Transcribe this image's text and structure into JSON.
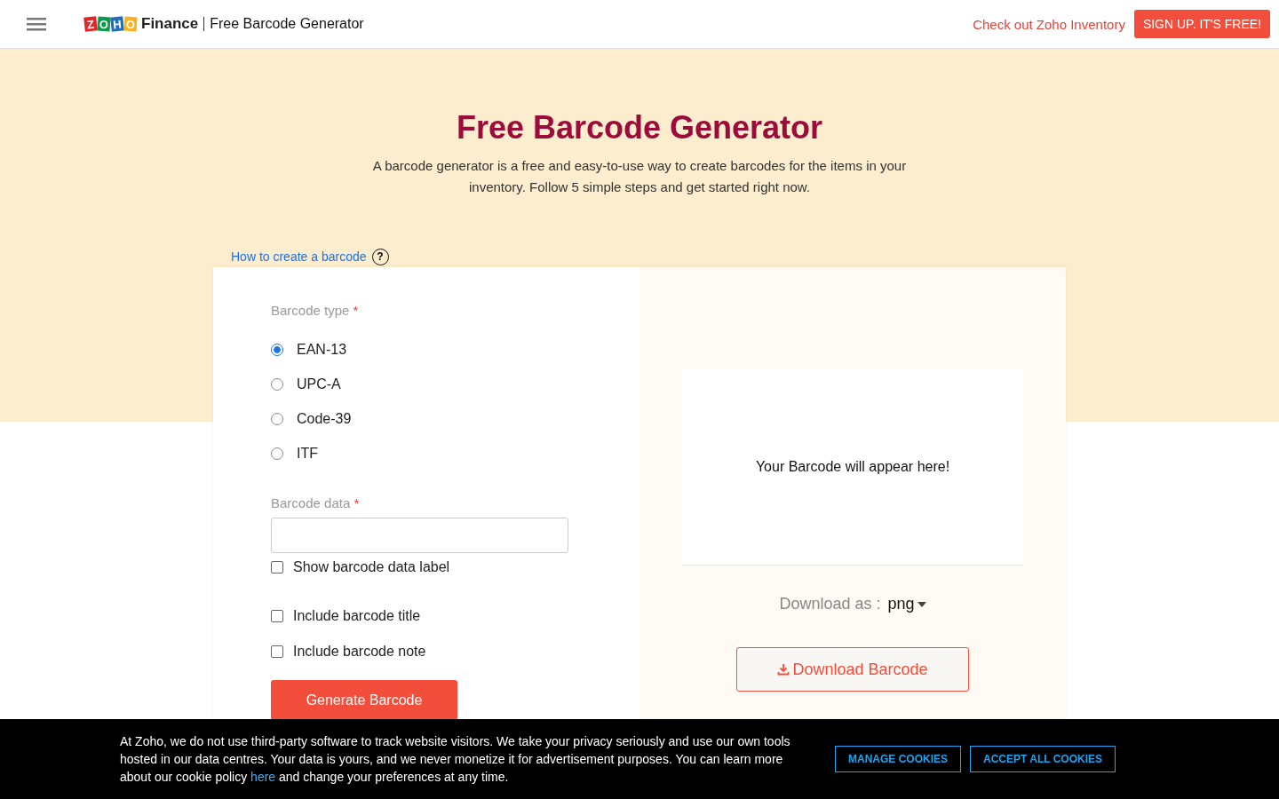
{
  "header": {
    "logo_letters": [
      {
        "text": "Z",
        "color": "#e42527"
      },
      {
        "text": "O",
        "color": "#089949"
      },
      {
        "text": "H",
        "color": "#226db4"
      },
      {
        "text": "O",
        "color": "#f9b21d"
      }
    ],
    "brand": "Finance",
    "page_name": "Free Barcode Generator",
    "link": "Check out Zoho Inventory",
    "signup": "SIGN UP. IT'S FREE!"
  },
  "hero": {
    "title": "Free Barcode Generator",
    "description": "A barcode generator is a free and easy-to-use way to create barcodes for the items in your inventory. Follow 5 simple steps and get started right now.",
    "help_link": "How to create a barcode",
    "help_icon": "?"
  },
  "form": {
    "type_label": "Barcode type",
    "required_mark": "*",
    "types": [
      {
        "label": "EAN-13",
        "selected": true
      },
      {
        "label": "UPC-A",
        "selected": false
      },
      {
        "label": "Code-39",
        "selected": false
      },
      {
        "label": "ITF",
        "selected": false
      }
    ],
    "data_label": "Barcode data",
    "data_required_mark": "*",
    "options": [
      {
        "label": "Show barcode data label",
        "checked": false
      },
      {
        "label": "Include barcode title",
        "checked": false
      },
      {
        "label": "Include barcode note",
        "checked": false
      }
    ],
    "generate": "Generate Barcode"
  },
  "preview": {
    "placeholder": "Your Barcode will appear here!",
    "download_label": "Download as :",
    "format": "png",
    "download_button": "Download Barcode"
  },
  "cookie_banner": {
    "text_before": "At Zoho, we do not use third-party software to track website visitors. We take your privacy seriously and use our own tools hosted in our data centres. Your data is yours, and we never monetize it for advertisement purposes. You can learn more about our cookie policy",
    "link": "here",
    "text_after": "and change your preferences at any time.",
    "buttons": [
      "MANAGE COOKIES",
      "ACCEPT ALL COOKIES"
    ]
  }
}
